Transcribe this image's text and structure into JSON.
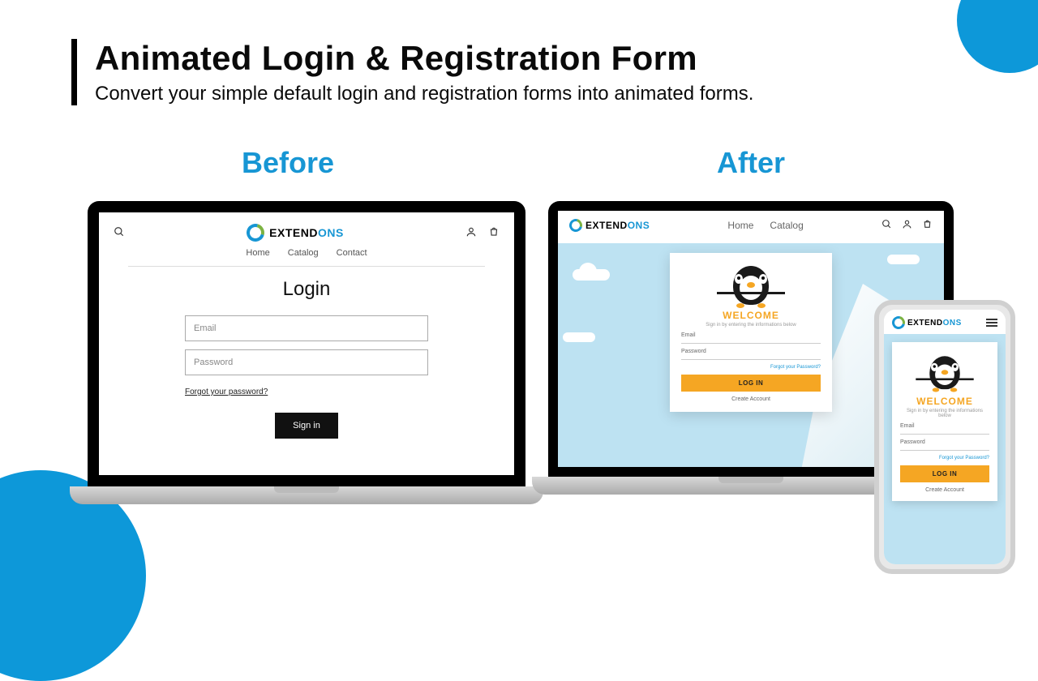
{
  "header": {
    "title": "Animated Login & Registration Form",
    "subtitle": "Convert your simple default login and registration forms into animated forms."
  },
  "labels": {
    "before": "Before",
    "after": "After"
  },
  "brand": {
    "name_plain": "EXTEND",
    "name_accent": "ONS"
  },
  "before": {
    "menu": [
      "Home",
      "Catalog",
      "Contact"
    ],
    "login_title": "Login",
    "email_placeholder": "Email",
    "password_placeholder": "Password",
    "forgot": "Forgot your password?",
    "signin": "Sign in"
  },
  "after": {
    "menu": [
      "Home",
      "Catalog"
    ],
    "welcome": "WELCOME",
    "sub": "Sign in by entering the informations below",
    "email_label": "Email",
    "password_label": "Password",
    "forgot": "Forgot your Password?",
    "login_btn": "LOG IN",
    "create": "Create Account"
  }
}
